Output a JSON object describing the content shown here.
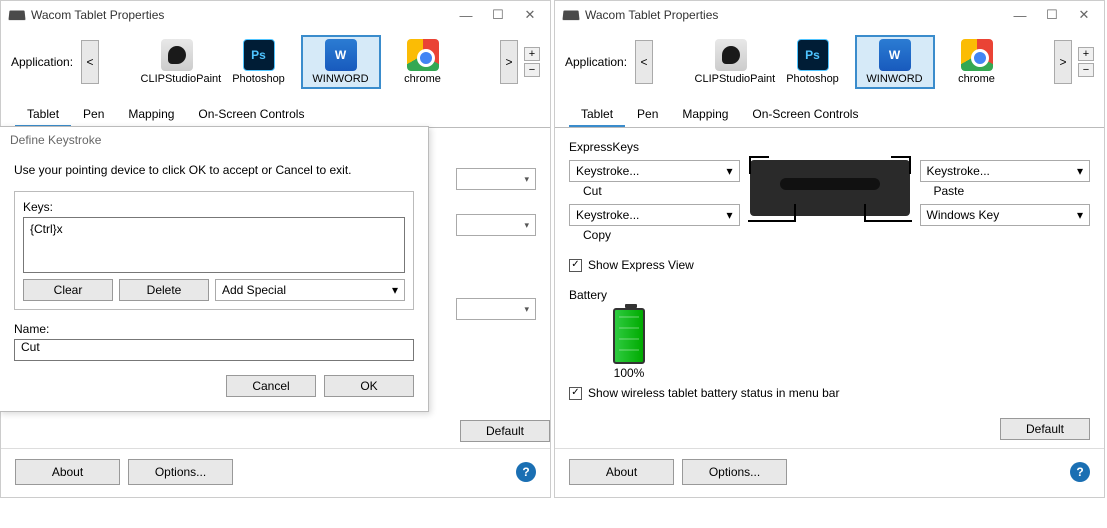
{
  "window_title": "Wacom Tablet Properties",
  "app_label": "Application:",
  "apps": [
    "CLIPStudioPaint",
    "Photoshop",
    "WINWORD",
    "chrome"
  ],
  "tabs": [
    "Tablet",
    "Pen",
    "Mapping",
    "On-Screen Controls"
  ],
  "default_btn": "Default",
  "about_btn": "About",
  "options_btn": "Options...",
  "dialog": {
    "title": "Define Keystroke",
    "instruction": "Use your pointing device to click OK to accept or Cancel to exit.",
    "keys_label": "Keys:",
    "keys_value": "{Ctrl}x",
    "clear": "Clear",
    "delete": "Delete",
    "add_special": "Add Special",
    "name_label": "Name:",
    "name_value": "Cut",
    "cancel": "Cancel",
    "ok": "OK"
  },
  "right": {
    "express_keys": "ExpressKeys",
    "key_tl": "Keystroke...",
    "key_tl_sub": "Cut",
    "key_bl": "Keystroke...",
    "key_bl_sub": "Copy",
    "key_tr": "Keystroke...",
    "key_tr_sub": "Paste",
    "key_br": "Windows Key",
    "show_express": "Show Express View",
    "battery_label": "Battery",
    "battery_pct": "100%",
    "show_battery": "Show wireless tablet battery status in menu bar"
  }
}
